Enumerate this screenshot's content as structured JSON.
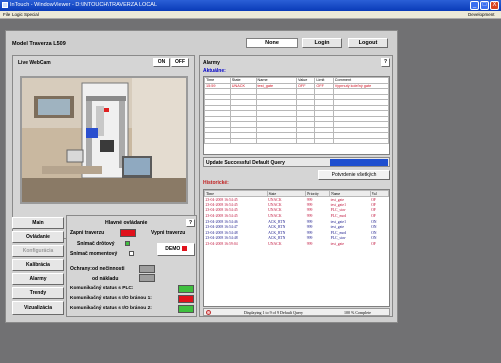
{
  "titlebar": {
    "text": "InTouch - WindowViewer - D:\\INTOUCH\\TRAVERZA LOCAL",
    "min": "_",
    "max": "□",
    "close": "X"
  },
  "menubar": {
    "items": [
      "File",
      "Logic",
      "Special"
    ],
    "right": "Development"
  },
  "header": {
    "model_title": "Model Traverza L509",
    "user": "None",
    "login": "Login",
    "logout": "Logout"
  },
  "webcam": {
    "title": "Live WebCam",
    "on": "ON",
    "off": "OFF"
  },
  "alarms": {
    "title": "Alarmy",
    "help": "?",
    "current_label": "Aktuálne:",
    "current_columns": [
      "Time",
      "State",
      "Name",
      "Value",
      "Limit",
      "Comment"
    ],
    "current_rows": [
      [
        "15:59",
        "UNACK",
        "test_gate",
        "OFF",
        "OFF",
        "Vyprnutý koleľný gate"
      ]
    ],
    "status_text": "Update Successful Default Query",
    "confirm_all": "Potvrdenie všetkých",
    "history_label": "Historické:",
    "history_columns": [
      "Time",
      "State",
      "Priority",
      "Name",
      "Val"
    ],
    "history_rows": [
      {
        "time": "23-04-2008 16:54:45",
        "state": "UNACK",
        "priority": "999",
        "name": "test_gate",
        "val": "OF",
        "color": "#c0143c"
      },
      {
        "time": "23-04-2008 16:54:45",
        "state": "UNACK",
        "priority": "999",
        "name": "test_gate1",
        "val": "OF",
        "color": "#c0143c"
      },
      {
        "time": "23-04-2008 16:54:45",
        "state": "UNACK",
        "priority": "999",
        "name": "PLC_stav",
        "val": "OF",
        "color": "#c0143c"
      },
      {
        "time": "23-04-2008 16:54:45",
        "state": "UNACK",
        "priority": "999",
        "name": "PLC_mod",
        "val": "OF",
        "color": "#c0143c"
      },
      {
        "time": "23-04-2008 16:54:46",
        "state": "ACK_RTN",
        "priority": "999",
        "name": "test_gate1",
        "val": "ON",
        "color": "#1a1a8c"
      },
      {
        "time": "23-04-2008 16:54:47",
        "state": "ACK_RTN",
        "priority": "999",
        "name": "test_gate",
        "val": "ON",
        "color": "#1a1a8c"
      },
      {
        "time": "23-04-2008 16:54:48",
        "state": "ACK_RTN",
        "priority": "999",
        "name": "PLC_mod",
        "val": "ON",
        "color": "#1a1a8c"
      },
      {
        "time": "23-04-2008 16:54:48",
        "state": "ACK_RTN",
        "priority": "999",
        "name": "PLC_stav",
        "val": "ON",
        "color": "#1a1a8c"
      },
      {
        "time": "23-04-2008 16:59:04",
        "state": "UNACK",
        "priority": "999",
        "name": "test_gate",
        "val": "OF",
        "color": "#c0143c"
      }
    ],
    "footer_displaying": "Displaying 1 to 9 of 9 Default Query",
    "footer_complete": "100 % Complete"
  },
  "nav": {
    "items": [
      "Main",
      "Ovládanie",
      "Konfigurácia",
      "Kalibrácia",
      "Alarmy",
      "Trendy",
      "Vizualizácia"
    ]
  },
  "control": {
    "title": "Hlavné ovládanie",
    "help": "?",
    "start": "Zapni traverzu",
    "stop": "Vypni traverzu",
    "sensor_wire": "Snímač drôtový",
    "sensor_moment": "Snímač momentový",
    "demo": "DEMO",
    "protect_label": "Ochrany:",
    "protect_idle": "od nečinnosti",
    "protect_load": "od nákladu",
    "plc_status": "Komunikačný status s PLC:",
    "io1_status": "Komunikačný status s I/O bránou 1:",
    "io2_status": "Komunikačný status s I/O bránou 2:"
  },
  "colors": {
    "red": "#e0121c",
    "green": "#3fbf3f",
    "gray": "#9e9e9e",
    "title_blue": "#0a3bb8",
    "status_blue": "#1f4fcf",
    "alarm_blue": "#0000c8"
  }
}
